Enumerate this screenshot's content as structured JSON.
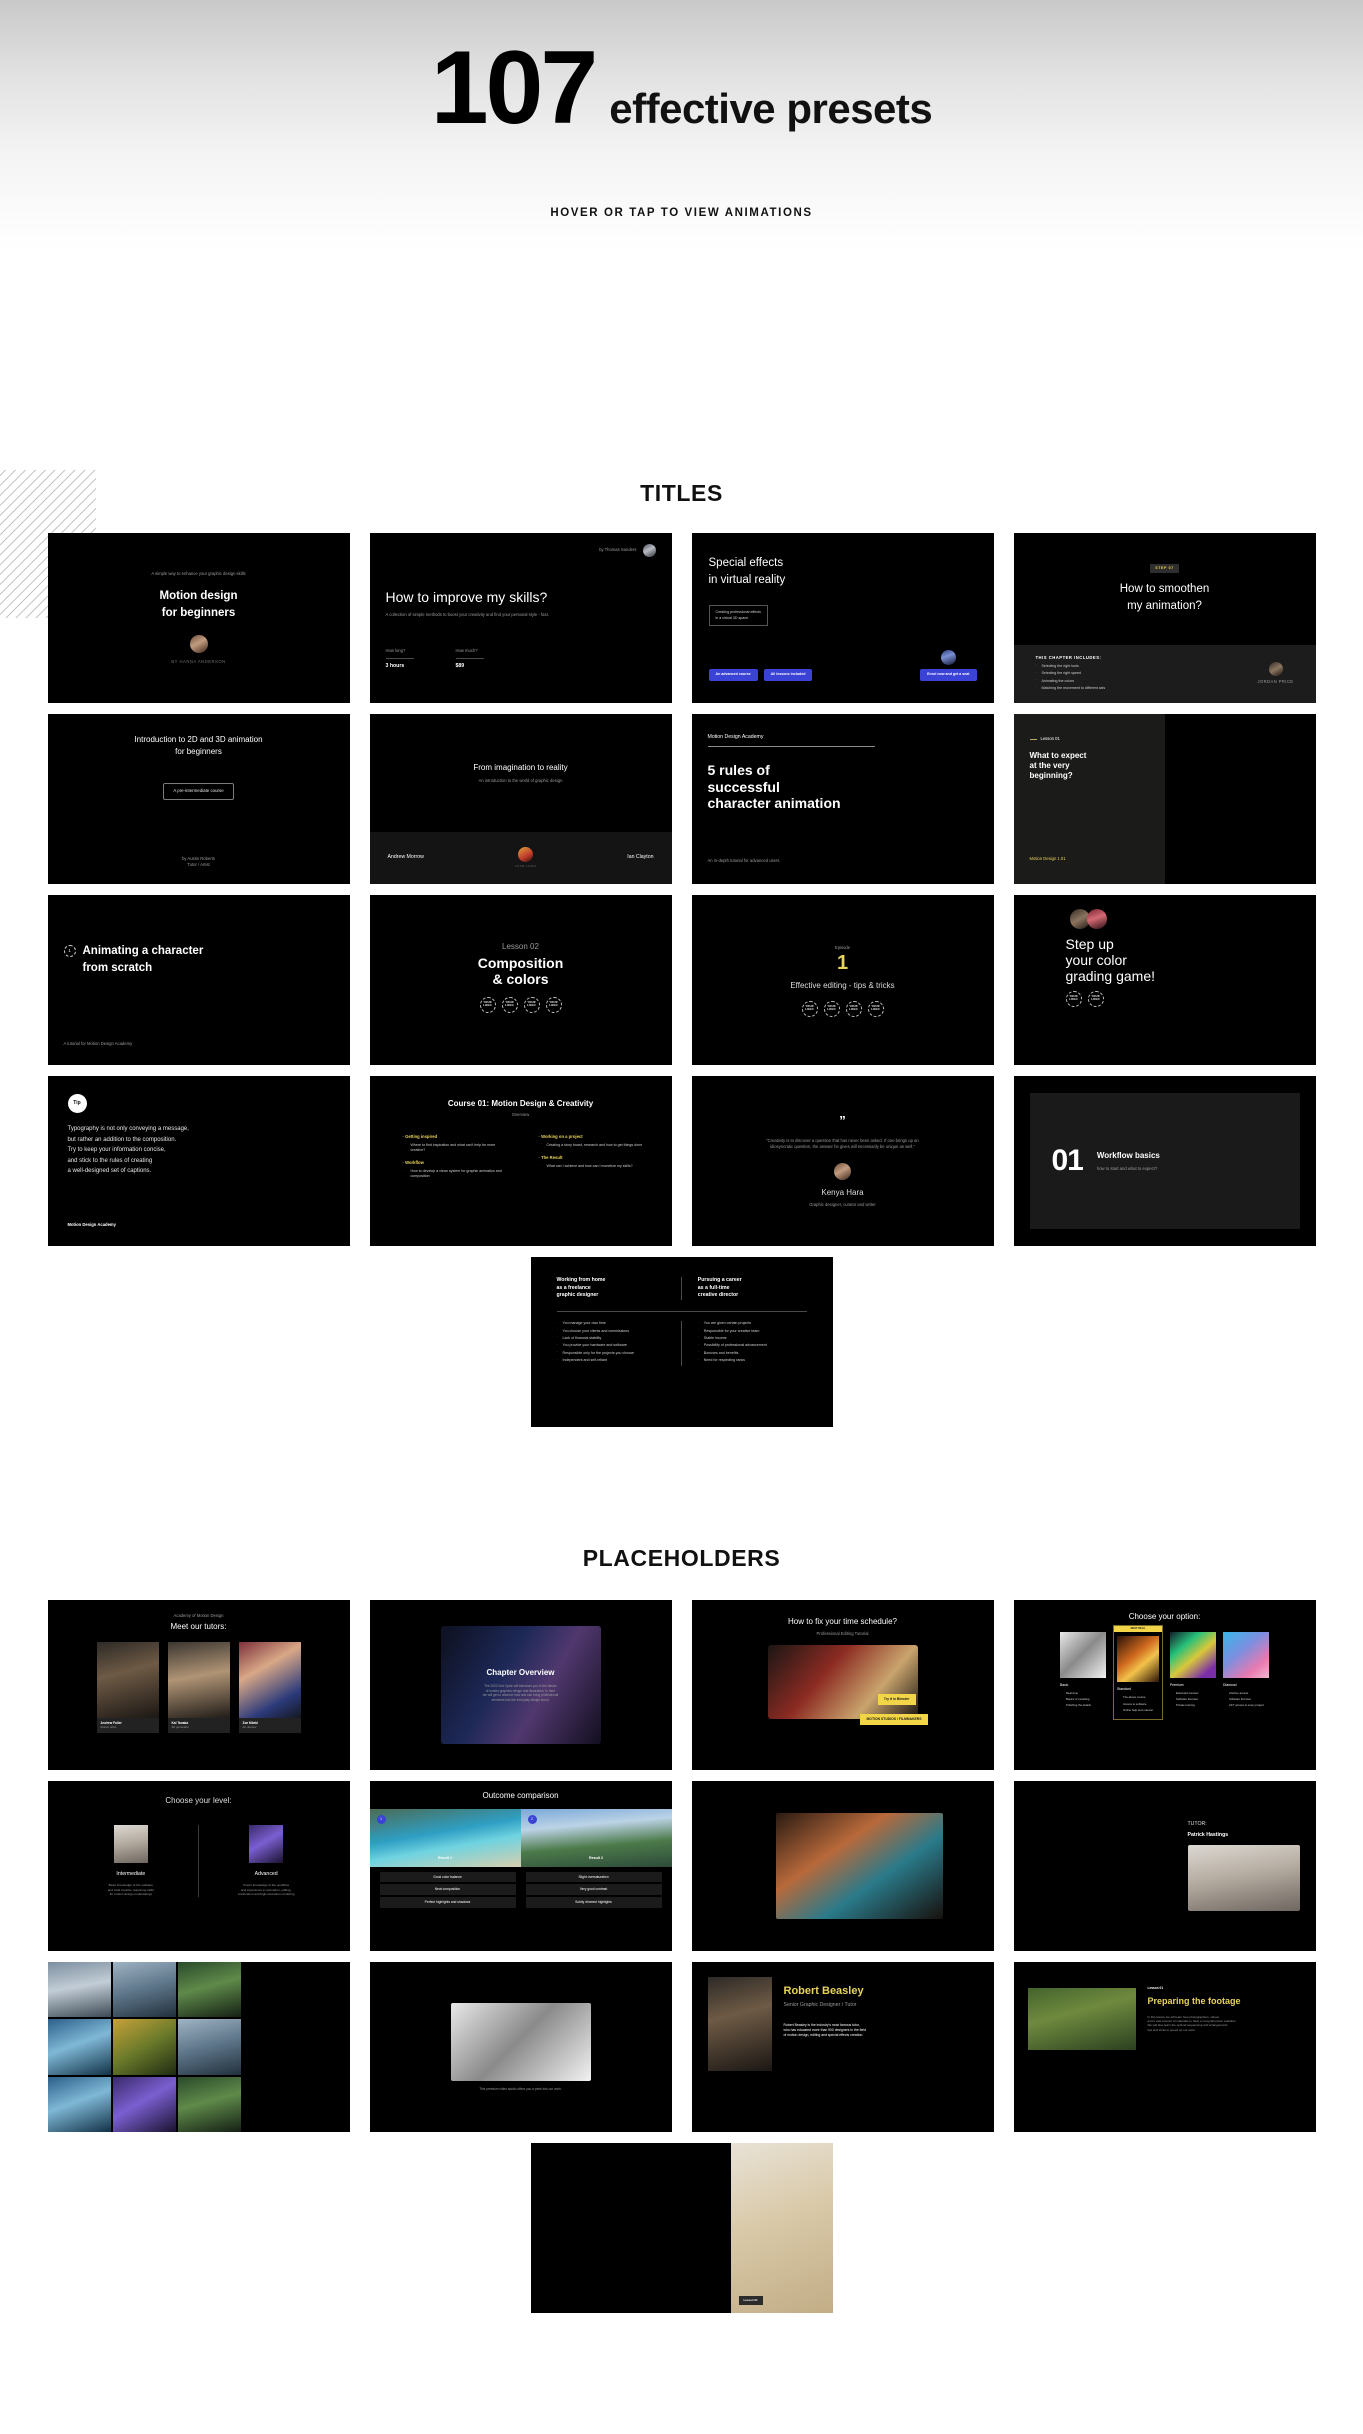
{
  "hero": {
    "count": "107",
    "subtitle": "effective presets",
    "tagline": "HOVER OR TAP TO VIEW ANIMATIONS"
  },
  "sections": [
    {
      "id": "titles",
      "title": "TITLES"
    },
    {
      "id": "placeholders",
      "title": "PLACEHOLDERS"
    }
  ],
  "titles": {
    "c1": {
      "eyebrow": "A simple way to enhance your graphic design skills",
      "title_l1": "Motion design",
      "title_l2": "for beginners",
      "author": "BY HANNA ANDERSON"
    },
    "c2": {
      "byline": "by Thomas Sanders",
      "title": "How to improve my skills?",
      "subtitle": "A collection of simple methods to boost your creativity and find your personal style - fast.",
      "stat1_label": "How long?",
      "stat1_value": "3 hours",
      "stat2_label": "How much?",
      "stat2_value": "$89"
    },
    "c3": {
      "title_l1": "Special effects",
      "title_l2": "in virtual reality",
      "note_l1": "Creating professional effects",
      "note_l2": "in a virtual 3D space",
      "btn1": "An advanced course",
      "btn2": "All lessons included",
      "btn3": "Enrol now and get a seat"
    },
    "c4": {
      "step_label": "STEP",
      "step_value": "07",
      "title_l1": "How to smoothen",
      "title_l2": "my animation?",
      "list_title": "THIS CHAPTER INCLUDES:",
      "items": [
        "Selecting the right tools",
        "Selecting the right speed",
        "Animating the colors",
        "Matching the movement to different axis"
      ],
      "author": "JORDAN PRICE"
    },
    "c5": {
      "title_l1": "Introduction to 2D and 3D animation",
      "title_l2": "for beginners",
      "chip": "A pre-intermediate course",
      "author_l1": "by Austin Roberts",
      "author_l2": "Tutor / Artist"
    },
    "c6": {
      "title": "From imagination to reality",
      "subtitle": "An introduction to the world of graphic design",
      "left_name": "Andrew Morrow",
      "right_name": "Ian Clayton",
      "logo": "YOUR LOGO"
    },
    "c7": {
      "brand": "Motion Design Academy",
      "title_l1": "5 rules of",
      "title_l2": "successful",
      "title_l3": "character animation",
      "footer": "An in-depth tutorial for advanced users"
    },
    "c8": {
      "lesson": "Lesson 01",
      "title_l1": "What to expect",
      "title_l2": "at the very",
      "title_l3": "beginning?",
      "footer": "Motion Design 1.01"
    },
    "c9": {
      "number": "1",
      "title_l1": "Animating a character",
      "title_l2": "from scratch",
      "footer": "A tutorial for Motion Design Academy"
    },
    "c10": {
      "lesson": "Lesson 02",
      "title_l1": "Composition",
      "title_l2": "& colors",
      "logo": "YOUR LOGO",
      "logo_count": 4
    },
    "c11": {
      "eyebrow": "Episode",
      "number": "1",
      "title": "Effective editing - tips & tricks",
      "logo": "YOUR LOGO",
      "logo_count": 4
    },
    "c12": {
      "title_l1": "Step up",
      "title_l2": "your color",
      "title_l3": "grading game!",
      "logo": "YOUR LOGO",
      "logo_count": 2
    },
    "c13": {
      "badge": "Tip",
      "body_l1": "Typography is not only conveying a message,",
      "body_l2": "but rather an addition to the composition.",
      "body_l3": "Try to keep your information concise,",
      "body_l4": "and stick to the rules of creating",
      "body_l5": "a well-designed set of captions.",
      "footer": "Motion Design Academy"
    },
    "c14": {
      "title": "Course 01: Motion Design & Creativity",
      "subtitle": "Overview",
      "col1": [
        {
          "head": "Getting inspired",
          "items": [
            "Where to find inspiration and what can't help be more creative?"
          ]
        },
        {
          "head": "Workflow",
          "items": [
            "How to develop a clean system for graphic animation and composition"
          ]
        }
      ],
      "col2": [
        {
          "head": "Working on a project",
          "items": [
            "Creating a story board, research and how to get things done"
          ]
        },
        {
          "head": "The Result",
          "items": [
            "What can I achieve and how can I monetize my skills?"
          ]
        }
      ]
    },
    "c15": {
      "mark": "”",
      "quote_l1": "“Creativity is to discover a question that has never been asked. If one brings up an",
      "quote_l2": "idiosyncratic question, the answer he gives will necessarily be unique as well.”",
      "name": "Kenya Hara",
      "role": "Graphic designer, curator and writer"
    },
    "c16": {
      "number": "01",
      "title": "Workflow basics",
      "subtitle": "how to start and what to expect?"
    },
    "c17": {
      "left_title_l1": "Working from home",
      "left_title_l2": "as a freelance",
      "left_title_l3": "graphic designer",
      "right_title_l1": "Pursuing a career",
      "right_title_l2": "as a full-time",
      "right_title_l3": "creative director",
      "left_items": [
        "You manage your own time",
        "You choose your clients and commissions",
        "Lack of financial stability",
        "You provide your hardware and software",
        "Responsible only for the projects you choose",
        "Independent and self-reliant"
      ],
      "right_items": [
        "You are given certain projects",
        "Responsible for your creative team",
        "Stable income",
        "Possibility of professional advancement",
        "Bonuses and benefits",
        "Need for respecting ranks"
      ]
    }
  },
  "placeholders": {
    "p1": {
      "eyebrow": "Academy of Motion Design",
      "title": "Meet our tutors:",
      "names": [
        "Andrew Fuller",
        "Kai Tanaka",
        "Zoe Mbeki"
      ],
      "roles": [
        "Motion artist",
        "3D generalist",
        "Art director"
      ]
    },
    "p2": {
      "title": "Chapter Overview",
      "body_l1": "The 2022 2nd Cycle will introduce you to the basics",
      "body_l2": "of motion graphics design and illustration. In here",
      "body_l3": "we will get to observe how one can bring professional",
      "body_l4": "elements into the everyday design world."
    },
    "p3": {
      "title": "How to fix your time schedule?",
      "subtitle": "Professional Editing Tutorial",
      "btn_small": "Try it in Blender",
      "btn_big": "MOTION STUDIOS / FILMMAKERS"
    },
    "p4": {
      "title": "Choose your option:",
      "ribbon": "BEST DEAL",
      "tiers": [
        {
          "name": "Basic",
          "items": [
            "Real-time",
            "Basics of modeling",
            "Polishing the details"
          ]
        },
        {
          "name": "Standard",
          "items": [
            "The above course",
            "Access to software",
            "Online help and manual"
          ]
        },
        {
          "name": "Premium",
          "items": [
            "Extended courses",
            "Software licenses",
            "Private tutoring"
          ]
        },
        {
          "name": "Diamond",
          "items": [
            "Lifetime access",
            "Software licenses",
            "24/7 access to every project"
          ]
        }
      ]
    },
    "p5": {
      "title": "Choose your level:",
      "left_name": "Intermediate",
      "left_desc_l1": "Basic knowledge of the software",
      "left_desc_l2": "and solid creative reasoning skills",
      "left_desc_l3": "for motion design undertakings",
      "right_name": "Advanced",
      "right_desc_l1": "Fluent knowledge of the workflow",
      "right_desc_l2": "and experience in animation, editing,",
      "right_desc_l3": "colorization and high-resolution rendering"
    },
    "p6": {
      "title": "Outcome comparison",
      "badge1": "1",
      "badge2": "2",
      "label1": "Result 1",
      "label2": "Result 2",
      "rows1": [
        "Good color balance",
        "Neat composition",
        "Perfect highlights and shadows"
      ],
      "rows2": [
        "Slight oversaturation",
        "Very good contrast",
        "Subtly dimmed highlights"
      ]
    },
    "p7": {
      "caption": ""
    },
    "p8": {
      "eyebrow": "TUTOR:",
      "name": "Patrick Hastings"
    },
    "p9": {
      "caption": ""
    },
    "p10": {
      "caption": "This premium video studio offers you a peek into our work."
    },
    "p11": {
      "name": "Robert Beasley",
      "role": "Senior Graphic Designer / Tutor",
      "bio_l1": "Robert Beasley is the industry's most famous tutor,",
      "bio_l2": "who has educated more than 900 designers in the field",
      "bio_l3": "of motion design, editing and special effects creation."
    },
    "p12": {
      "lesson": "Lesson 01",
      "title": "Preparing the footage",
      "body_l1": "In this lesson we will learn how photographers, videos",
      "body_l2": "and a vast amount of materials to have a comprehensive workflow.",
      "body_l3": "We will also learn the optimal sequencing and arrangements",
      "body_l4": "tips and tricks to speed up our work."
    },
    "p13": {
      "badge": "Lesson 01"
    }
  },
  "colors": {
    "accent_blue": "#3b42d6",
    "accent_yellow": "#e8d45a",
    "card_bg": "#000000",
    "page_bg": "#ffffff"
  }
}
